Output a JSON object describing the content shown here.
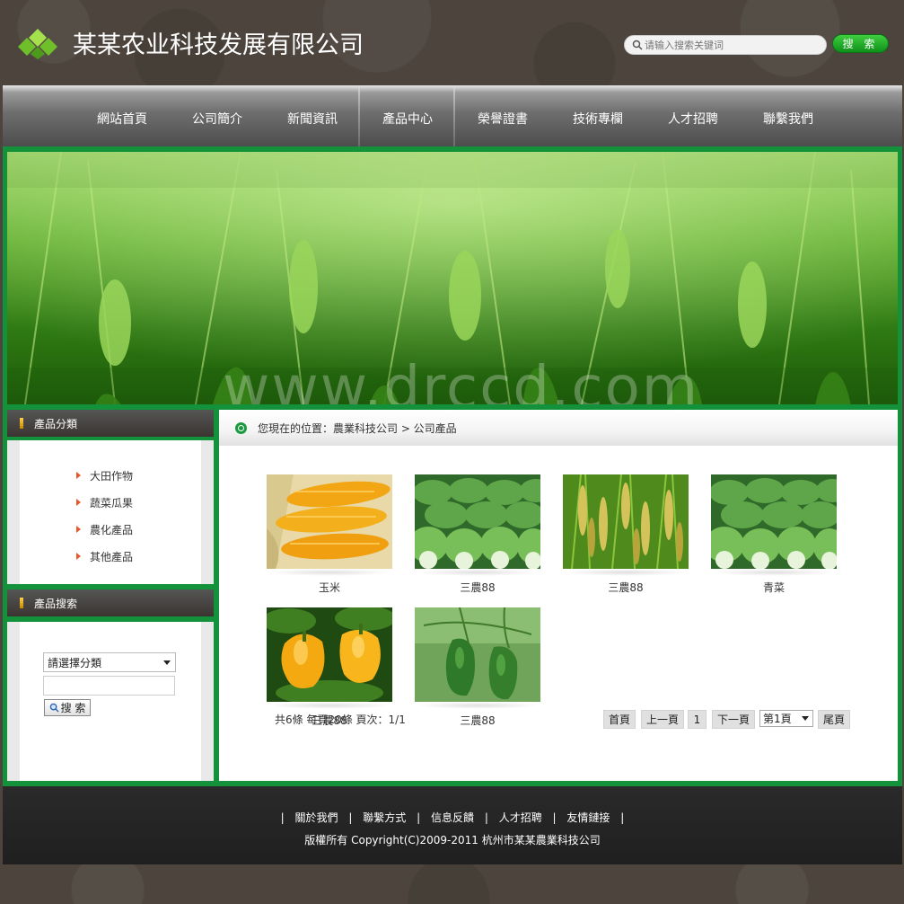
{
  "header": {
    "company_name": "某某农业科技发展有限公司",
    "search_placeholder": "请输入搜索关键词",
    "search_button": "搜 索"
  },
  "nav": {
    "items": [
      "網站首頁",
      "公司簡介",
      "新聞資訊",
      "產品中心",
      "榮譽證書",
      "技術專欄",
      "人才招聘",
      "聯繫我們"
    ]
  },
  "banner": {
    "watermark": "www.drccd.com"
  },
  "sidebar": {
    "category_title": "產品分類",
    "categories": [
      "大田作物",
      "蔬菜瓜果",
      "農化產品",
      "其他產品"
    ],
    "search_title": "產品搜索",
    "select_value": "請選擇分類",
    "search_button": "搜 索"
  },
  "breadcrumb": {
    "text": "您現在的位置：農業科技公司 > 公司產品"
  },
  "products": [
    {
      "name": "玉米",
      "image": "corn"
    },
    {
      "name": "三農88",
      "image": "cabbage"
    },
    {
      "name": "三農88",
      "image": "rice"
    },
    {
      "name": "青菜",
      "image": "cabbage"
    },
    {
      "name": "三農88",
      "image": "yellow-pepper"
    },
    {
      "name": "三農88",
      "image": "green-pepper"
    }
  ],
  "pagination": {
    "info": "共6條 每頁20條 頁次：1/1",
    "first": "首頁",
    "prev": "上一頁",
    "current": "1",
    "next": "下一頁",
    "page_select": "第1頁",
    "last": "尾頁"
  },
  "footer": {
    "links": [
      "關於我們",
      "聯繫方式",
      "信息反饋",
      "人才招聘",
      "友情鏈接"
    ],
    "copyright": "版權所有 Copyright(C)2009-2011 杭州市某某農業科技公司"
  },
  "colors": {
    "frame_green": "#13923b",
    "header_bg": "#4c443d",
    "accent_orange": "#e8562a"
  }
}
